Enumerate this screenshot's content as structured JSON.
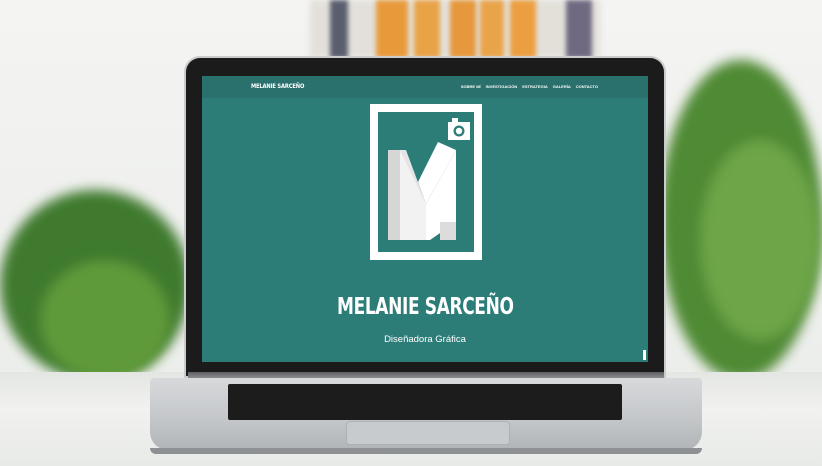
{
  "site": {
    "brand": "MELANIE SARCEÑO",
    "nav": [
      "SOBRE MÍ",
      "INVESTIGACIÓN",
      "ESTRATEGIA",
      "GALERÍA",
      "CONTACTO"
    ],
    "hero_title": "MELANIE SARCEÑO",
    "hero_subtitle": "Diseñadora Gráfica"
  },
  "colors": {
    "teal": "#2c7c78",
    "nav_bg": "#2a716d",
    "text": "#ffffff"
  },
  "icons": {
    "logo": "camera-monogram-m-icon"
  }
}
